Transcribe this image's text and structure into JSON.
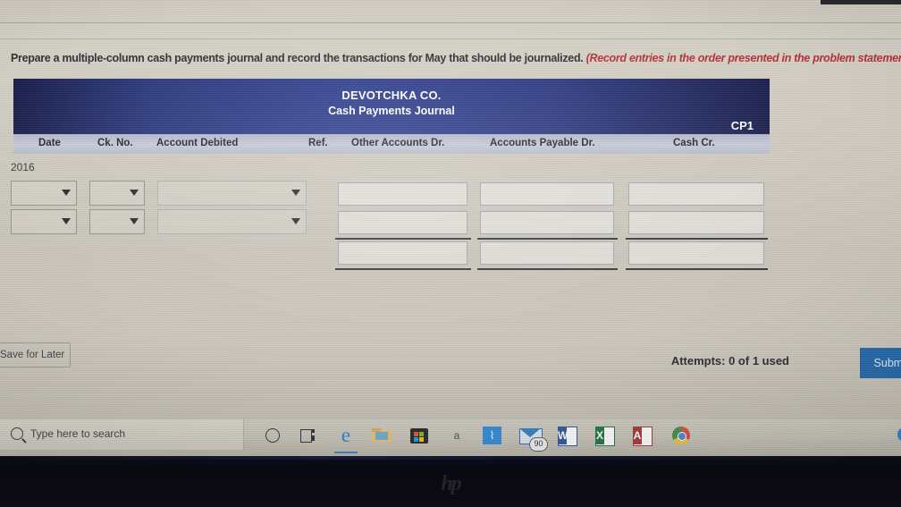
{
  "instruction": {
    "main": "Prepare a multiple-column cash payments journal and record the transactions for May that should be journalized.",
    "note": "(Record entries in the order presented in the problem statement.)"
  },
  "journal": {
    "company": "DEVOTCHKA CO.",
    "title": "Cash Payments Journal",
    "page_ref": "CP1",
    "year": "2016",
    "columns": [
      {
        "key": "date",
        "label": "Date"
      },
      {
        "key": "ck_no",
        "label": "Ck. No."
      },
      {
        "key": "account_debited",
        "label": "Account Debited"
      },
      {
        "key": "ref",
        "label": "Ref."
      },
      {
        "key": "other_accounts_dr",
        "label": "Other Accounts Dr."
      },
      {
        "key": "accounts_payable_dr",
        "label": "Accounts Payable Dr."
      },
      {
        "key": "cash_cr",
        "label": "Cash Cr."
      }
    ],
    "select_rows": [
      {
        "date": "",
        "ck_no": "",
        "account_debited": ""
      },
      {
        "date": "",
        "ck_no": "",
        "account_debited": ""
      }
    ],
    "amount_rows": [
      {
        "other_accounts_dr": "",
        "accounts_payable_dr": "",
        "cash_cr": ""
      },
      {
        "other_accounts_dr": "",
        "accounts_payable_dr": "",
        "cash_cr": ""
      },
      {
        "other_accounts_dr": "",
        "accounts_payable_dr": "",
        "cash_cr": ""
      }
    ],
    "colors": {
      "title_band": "#1b2a74",
      "header_row": "#c3c7d4"
    }
  },
  "actions": {
    "save_label": "Save for Later",
    "attempts_text": "Attempts: 0 of 1 used",
    "submit_label": "Submit",
    "submit_color": "#1f63a8"
  },
  "taskbar": {
    "search_placeholder": "Type here to search",
    "icons": [
      {
        "name": "cortana-icon",
        "label": "O"
      },
      {
        "name": "task-view-icon",
        "label": "⌸"
      },
      {
        "name": "edge-icon",
        "label": "e"
      },
      {
        "name": "file-explorer-icon",
        "label": ""
      },
      {
        "name": "microsoft-store-icon",
        "label": ""
      },
      {
        "name": "adobe-icon",
        "label": "a"
      },
      {
        "name": "sway-icon",
        "label": ""
      },
      {
        "name": "mail-icon",
        "label": "",
        "badge": "90"
      },
      {
        "name": "word-icon",
        "label": "W"
      },
      {
        "name": "excel-icon",
        "label": "X"
      },
      {
        "name": "access-icon",
        "label": "A"
      },
      {
        "name": "chrome-icon",
        "label": ""
      }
    ],
    "tray": [
      {
        "name": "help-icon"
      },
      {
        "name": "chevron-up-icon"
      },
      {
        "name": "battery-icon"
      },
      {
        "name": "wifi-icon"
      },
      {
        "name": "volume-icon"
      }
    ]
  },
  "device": {
    "brand": "hp"
  }
}
